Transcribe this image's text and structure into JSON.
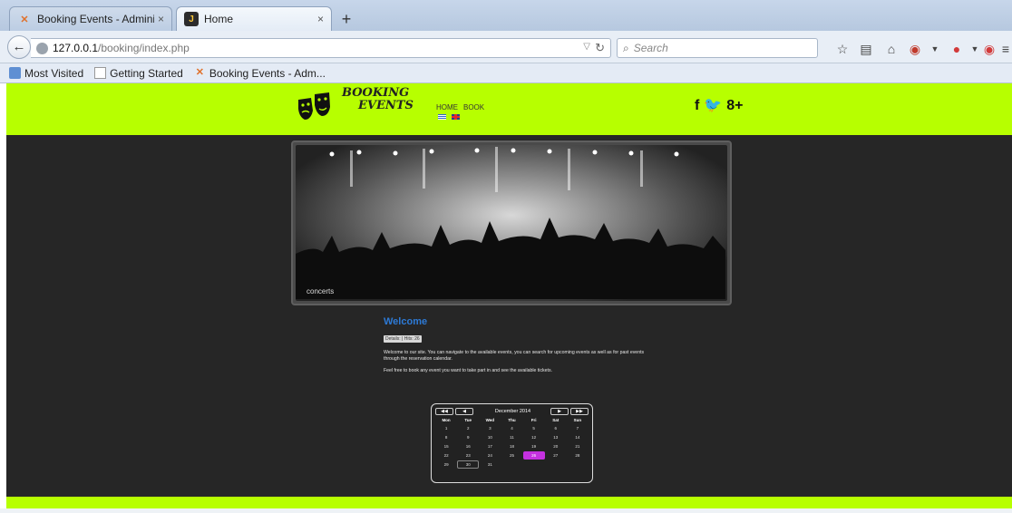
{
  "browser": {
    "tabs": [
      {
        "title": "Booking Events - Administ...",
        "active": false
      },
      {
        "title": "Home",
        "active": true
      }
    ],
    "url_host": "127.0.0.1",
    "url_path": "/booking/index.php",
    "search_placeholder": "Search",
    "bookmarks": [
      "Most Visited",
      "Getting Started",
      "Booking Events - Adm..."
    ]
  },
  "site": {
    "logo_line1": "BOOKING",
    "logo_line2": "EVENTS",
    "nav": [
      "HOME",
      "BOOK"
    ],
    "social": [
      "f",
      "🐦",
      "8+"
    ],
    "slider_caption": "concerts",
    "article": {
      "title": "Welcome",
      "details": "Details: | Hits: 26",
      "paragraph1": "Welcome to our site. You can navigate to the available events, you can search for upcoming events as well as for past events through the reservation calendar.",
      "paragraph2": "Feel free to book any event you want to take part in and see the available tickets."
    },
    "calendar": {
      "month": "December 2014",
      "weekdays": [
        "Mon",
        "Tue",
        "Wed",
        "Thu",
        "Fri",
        "Sat",
        "Sun"
      ],
      "weeks": [
        [
          "1",
          "2",
          "3",
          "4",
          "5",
          "6",
          "7"
        ],
        [
          "8",
          "9",
          "10",
          "11",
          "12",
          "13",
          "14"
        ],
        [
          "15",
          "16",
          "17",
          "18",
          "19",
          "20",
          "21"
        ],
        [
          "22",
          "23",
          "24",
          "25",
          "26",
          "27",
          "28"
        ],
        [
          "29",
          "30",
          "31",
          "",
          "",
          "",
          ""
        ]
      ],
      "event_day": "26",
      "today": "30"
    }
  },
  "colors": {
    "header_green": "#b7ff00",
    "body_dark": "#262626",
    "title_blue": "#2d7ad6",
    "event_purple": "#c531e0"
  }
}
